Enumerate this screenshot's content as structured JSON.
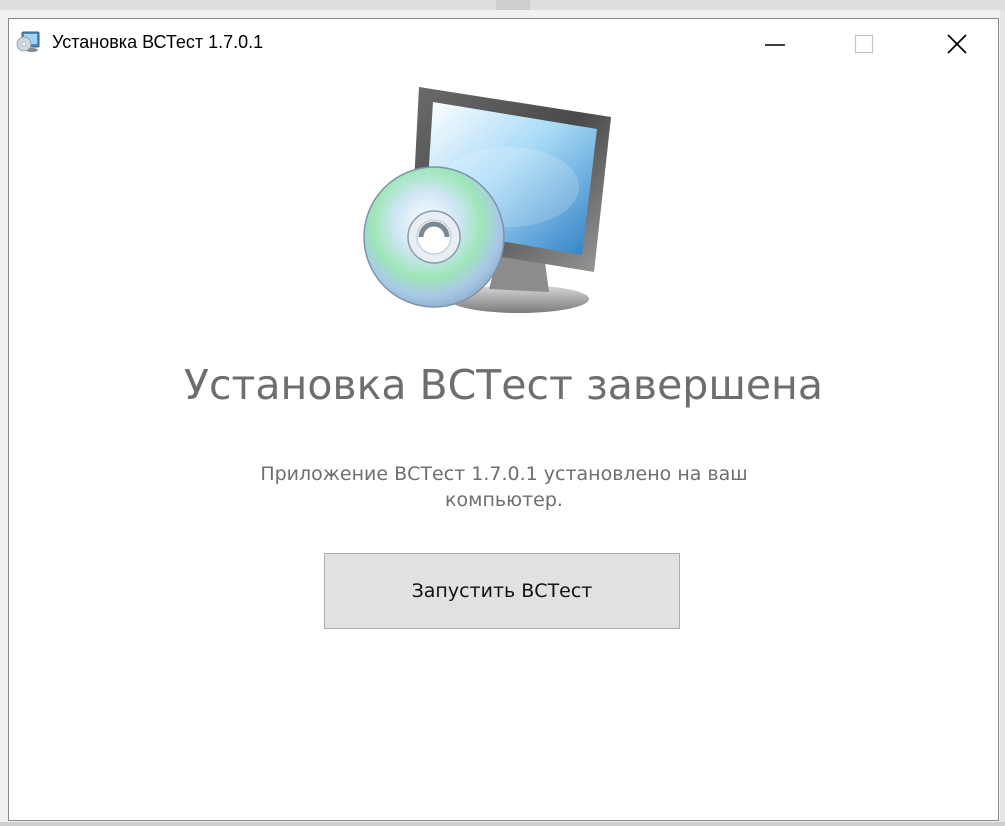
{
  "window": {
    "title": "Установка ВСТест 1.7.0.1"
  },
  "main": {
    "heading": "Установка ВСТест завершена",
    "description_line1": "Приложение ВСТест 1.7.0.1 установлено на ваш",
    "description_line2": "компьютер.",
    "launch_button_label": "Запустить ВСТест"
  },
  "icons": {
    "app": "installer-icon",
    "hero": "computer-with-disc-icon",
    "minimize": "minimize-icon",
    "maximize": "maximize-icon",
    "close": "close-icon"
  },
  "colors": {
    "heading_text": "#6e6e6e",
    "button_bg": "#e1e1e1",
    "button_border": "#adadad",
    "window_bg": "#ffffff"
  }
}
